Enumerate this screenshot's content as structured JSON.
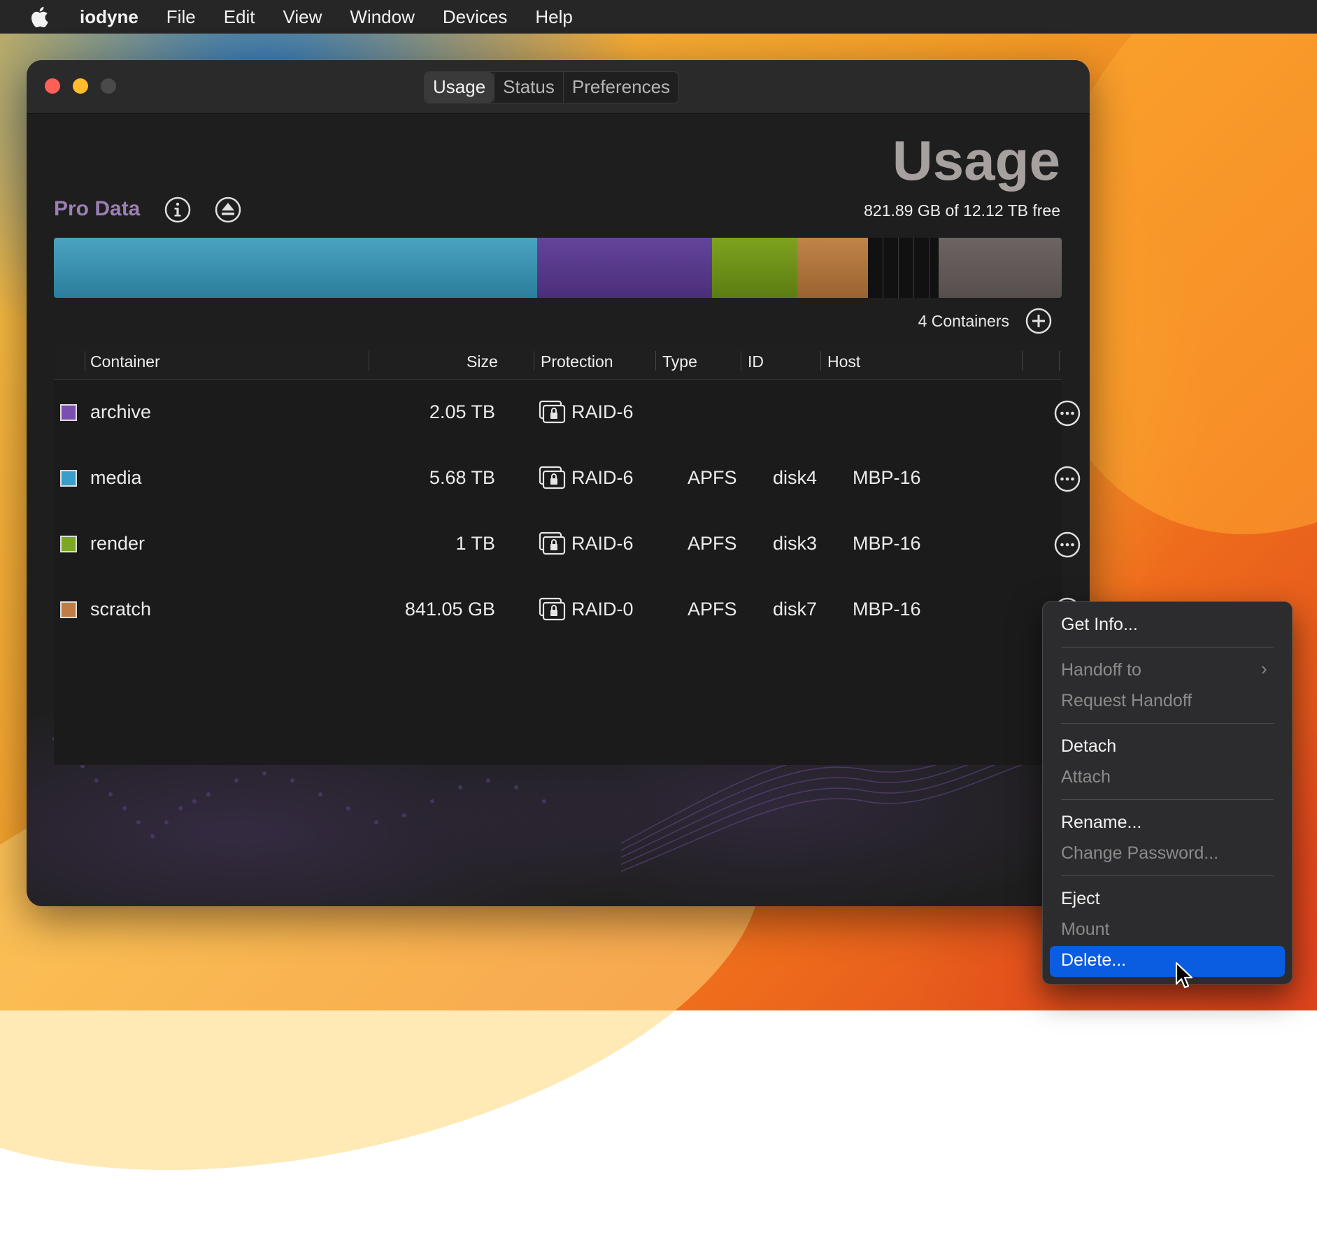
{
  "menubar": {
    "app_name": "iodyne",
    "items": [
      "File",
      "Edit",
      "View",
      "Window",
      "Devices",
      "Help"
    ]
  },
  "window": {
    "tabs": [
      {
        "label": "Usage",
        "active": true
      },
      {
        "label": "Status",
        "active": false
      },
      {
        "label": "Preferences",
        "active": false
      }
    ],
    "big_title": "Usage",
    "pool_name": "Pro Data",
    "free_text": "821.89 GB of 12.12 TB free",
    "containers_count": "4 Containers"
  },
  "usage_bar": {
    "segments": [
      {
        "name": "media",
        "color": "#3d94b4"
      },
      {
        "name": "archive",
        "color": "#573a8b"
      },
      {
        "name": "render",
        "color": "#6f9119"
      },
      {
        "name": "scratch",
        "color": "#af753e"
      },
      {
        "name": "reserved",
        "color": "#111111"
      },
      {
        "name": "free",
        "color": "#615a59"
      }
    ]
  },
  "table": {
    "headers": [
      "Container",
      "Size",
      "Protection",
      "Type",
      "ID",
      "Host"
    ],
    "rows": [
      {
        "name": "archive",
        "size": "2.05 TB",
        "protection": "RAID-6",
        "type": "",
        "id": "",
        "host": "",
        "color": "#7b4fb0"
      },
      {
        "name": "media",
        "size": "5.68 TB",
        "protection": "RAID-6",
        "type": "APFS",
        "id": "disk4",
        "host": "MBP-16",
        "color": "#3a9ec6"
      },
      {
        "name": "render",
        "size": "1 TB",
        "protection": "RAID-6",
        "type": "APFS",
        "id": "disk3",
        "host": "MBP-16",
        "color": "#7ba824"
      },
      {
        "name": "scratch",
        "size": "841.05 GB",
        "protection": "RAID-0",
        "type": "APFS",
        "id": "disk7",
        "host": "MBP-16",
        "color": "#bf7c44"
      }
    ]
  },
  "context_menu": {
    "items": [
      {
        "label": "Get Info...",
        "enabled": true
      },
      {
        "label": "Handoff to",
        "enabled": false,
        "submenu": true
      },
      {
        "label": "Request Handoff",
        "enabled": false
      },
      {
        "label": "Detach",
        "enabled": true
      },
      {
        "label": "Attach",
        "enabled": false
      },
      {
        "label": "Rename...",
        "enabled": true
      },
      {
        "label": "Change Password...",
        "enabled": false
      },
      {
        "label": "Eject",
        "enabled": true
      },
      {
        "label": "Mount",
        "enabled": false
      },
      {
        "label": "Delete...",
        "enabled": true,
        "highlighted": true
      }
    ]
  },
  "colors": {
    "accent_highlight": "#0a5ce0",
    "pool_name": "#9b7fb5"
  }
}
